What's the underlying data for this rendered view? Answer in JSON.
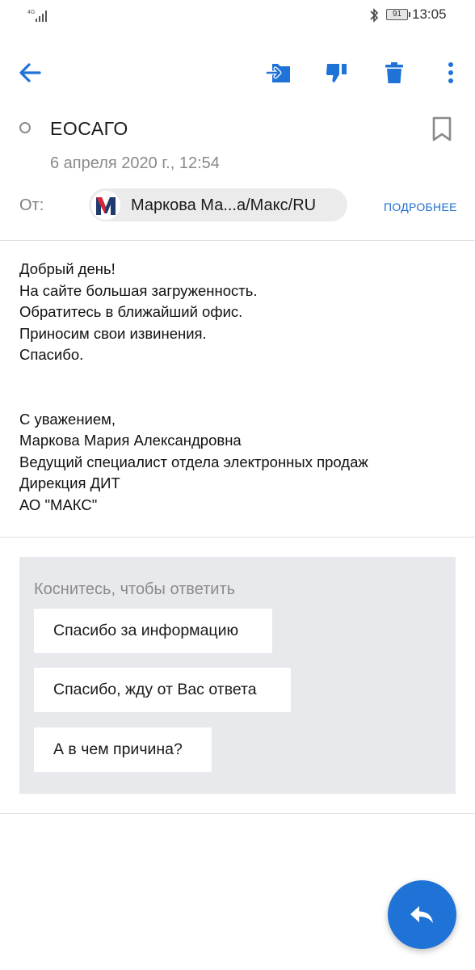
{
  "status_bar": {
    "network": "4G",
    "battery": "91",
    "time": "13:05"
  },
  "toolbar": {
    "back_icon": "arrow-left-icon",
    "move_icon": "move-to-folder-icon",
    "spam_icon": "thumbs-down-icon",
    "delete_icon": "trash-icon",
    "more_icon": "more-vertical-icon"
  },
  "message": {
    "subject": "ЕОСАГО",
    "date": "6 апреля 2020 г., 12:54",
    "from_label": "От:",
    "sender_name": "Маркова Ма...а/Макс/RU",
    "details_link": "ПОДРОБНЕЕ",
    "body_lines": [
      "Добрый день!",
      "На сайте большая загруженность.",
      "Обратитесь в ближайший офис.",
      "Приносим свои извинения.",
      "Спасибо."
    ],
    "signature_lines": [
      "С уважением,",
      "Маркова Мария Александровна",
      "Ведущий специалист отдела электронных продаж",
      "Дирекция ДИТ",
      "АО \"МАКС\""
    ]
  },
  "smart_reply": {
    "hint": "Коснитесь, чтобы ответить",
    "options": [
      "Спасибо за информацию",
      "Спасибо, жду от Вас ответа",
      "А в чем причина?"
    ]
  },
  "colors": {
    "accent": "#1f73d6",
    "panel": "#e8e9ec",
    "chip": "#ebebeb"
  }
}
